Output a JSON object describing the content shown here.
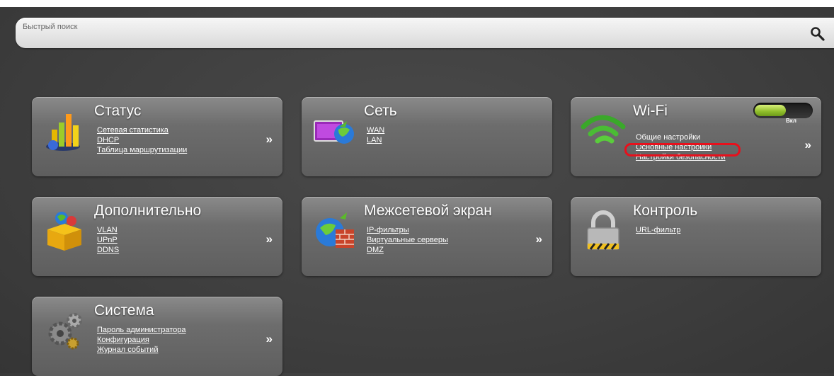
{
  "search": {
    "placeholder": "Быстрый поиск"
  },
  "tiles": {
    "status": {
      "title": "Статус",
      "links": [
        "Сетевая статистика",
        "DHCP",
        "Таблица маршрутизации"
      ],
      "arrow": "»"
    },
    "network": {
      "title": "Сеть",
      "links": [
        "WAN",
        "LAN"
      ],
      "arrow": ""
    },
    "wifi": {
      "title": "Wi-Fi",
      "toggle_label": "Вкл",
      "links": [
        "Общие настройки",
        "Основные настройки",
        "Настройки безопасности"
      ],
      "arrow": "»",
      "highlight_color": "#e8101c"
    },
    "advanced": {
      "title": "Дополнительно",
      "links": [
        "VLAN",
        "UPnP",
        "DDNS"
      ],
      "arrow": "»"
    },
    "firewall": {
      "title": "Межсетевой экран",
      "links": [
        "IP-фильтры",
        "Виртуальные серверы",
        "DMZ"
      ],
      "arrow": "»"
    },
    "control": {
      "title": "Контроль",
      "links": [
        "URL-фильтр"
      ],
      "arrow": ""
    },
    "system": {
      "title": "Система",
      "links": [
        "Пароль администратора",
        "Конфигурация",
        "Журнал событий"
      ],
      "arrow": "»"
    }
  },
  "icons": {
    "search": "magnifier-icon",
    "status": "bar-chart-icon",
    "network": "monitor-globe-icon",
    "wifi": "wifi-signal-icon",
    "advanced": "open-box-icon",
    "firewall": "globe-brick-wall-icon",
    "control": "padlock-icon",
    "system": "gears-icon"
  }
}
